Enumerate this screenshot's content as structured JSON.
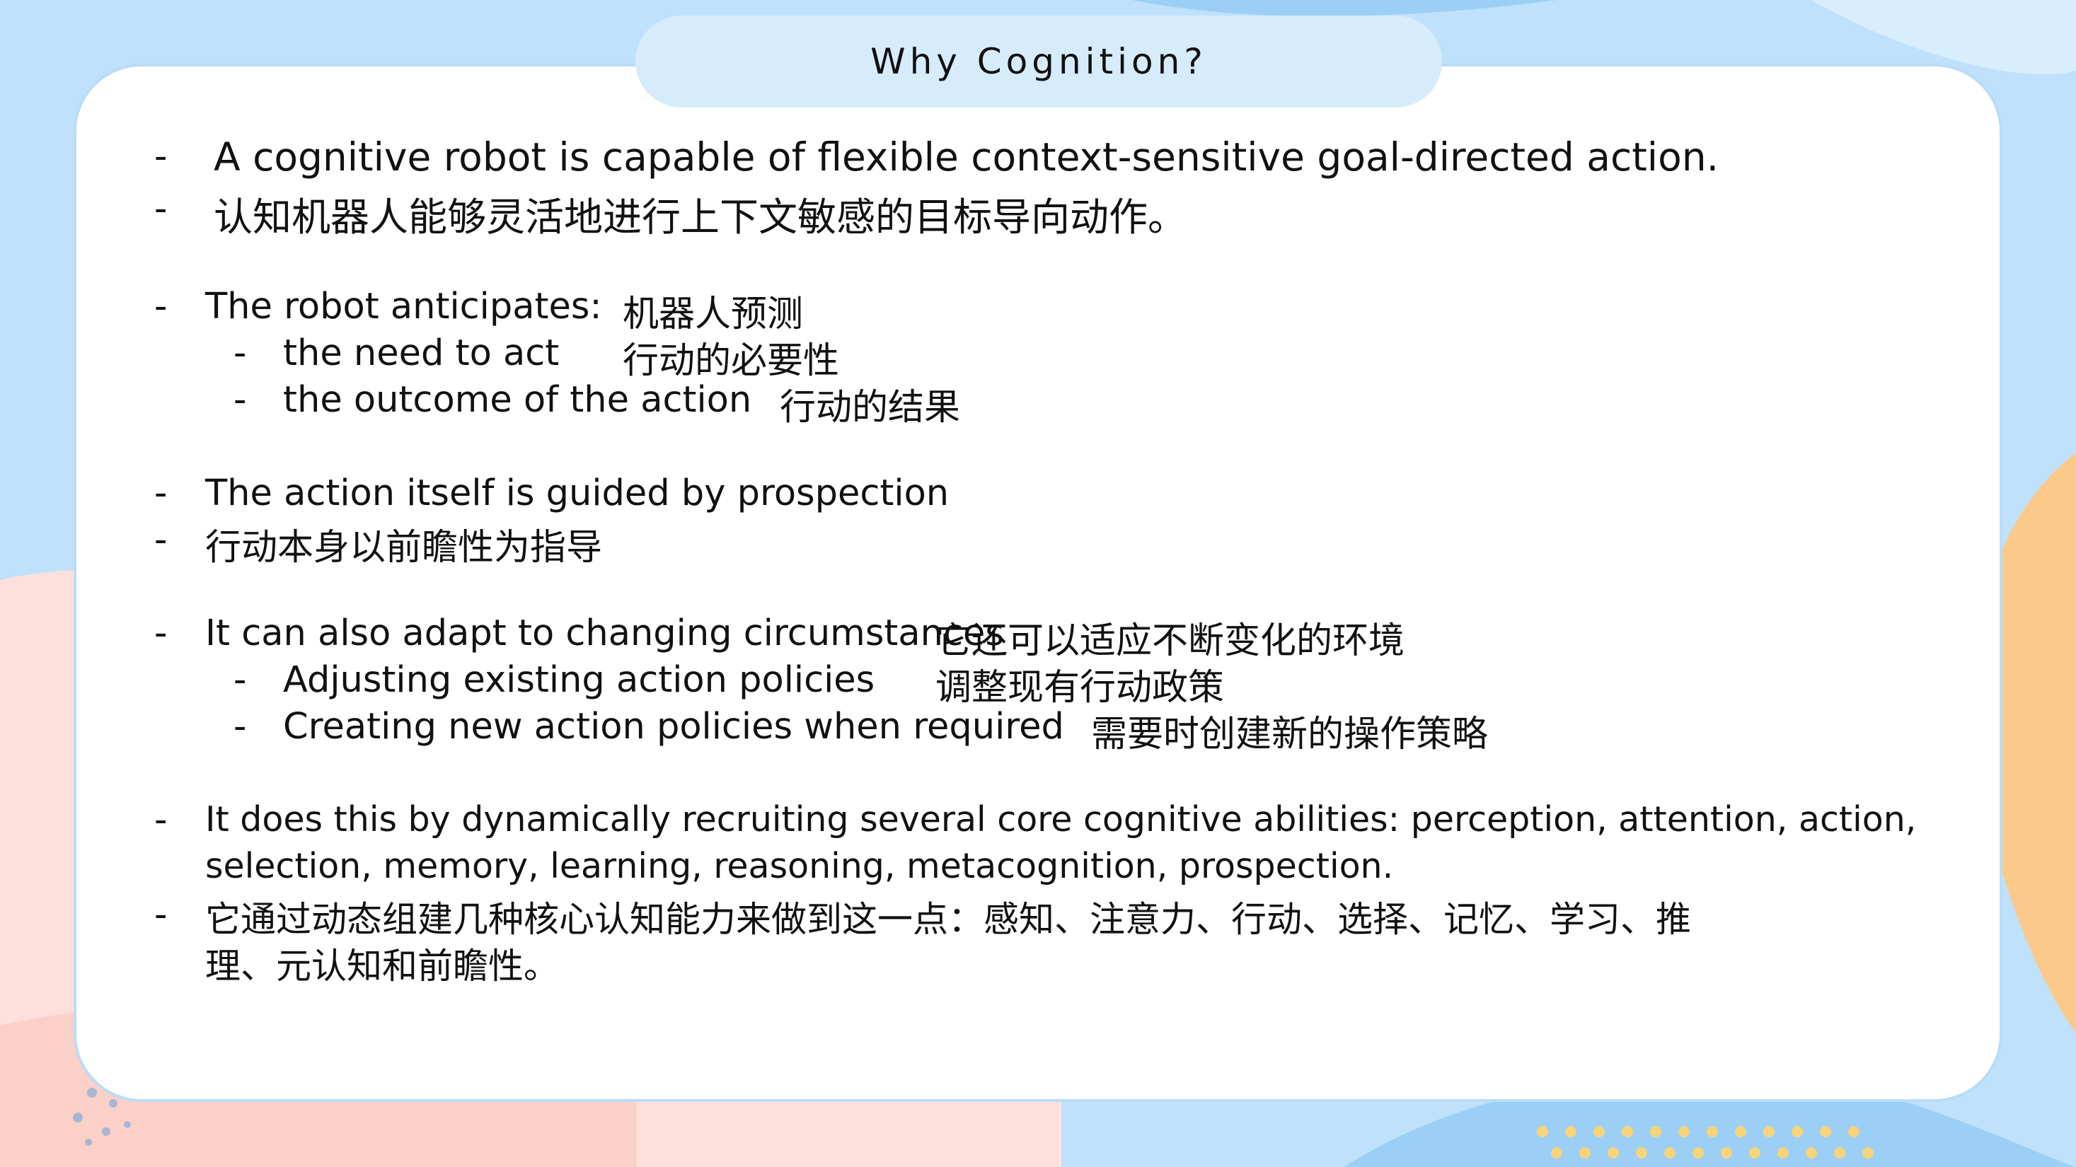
{
  "slide": {
    "title": "Why Cognition?",
    "bullets": {
      "b1_en": "A cognitive robot is capable of flexible context-sensitive goal-directed action.",
      "b1_zh": "认知机器人能够灵活地进行上下文敏感的目标导向动作。",
      "b2_en": "The robot anticipates:",
      "b2_zh": "机器人预测",
      "b2_sub1_en": "the need to act",
      "b2_sub1_zh": "行动的必要性",
      "b2_sub2_en": "the outcome of the action",
      "b2_sub2_zh": "行动的结果",
      "b3_en": "The action itself is guided by prospection",
      "b3_zh": "行动本身以前瞻性为指导",
      "b4_en": "It can also adapt to changing circumstances",
      "b4_zh": "它还可以适应不断变化的环境",
      "b4_sub1_en": "Adjusting existing action policies",
      "b4_sub1_zh": "调整现有行动政策",
      "b4_sub2_en": "Creating new action policies when required",
      "b4_sub2_zh": "需要时创建新的操作策略",
      "b5_en_line1": "It does this by dynamically recruiting several core cognitive abilities: perception, attention, action,",
      "b5_en_line2": "selection, memory, learning, reasoning, metacognition, prospection.",
      "b5_zh_line1": "它通过动态组建几种核心认知能力来做到这一点：感知、注意力、行动、选择、记忆、学习、推",
      "b5_zh_line2": "理、元认知和前瞻性。"
    },
    "dash": "-"
  },
  "colors": {
    "background_blue": "#bfe1fb",
    "accent_orange": "#fbc98a",
    "accent_pink": "#fde0dc",
    "dot_yellow": "#f7d47a",
    "card": "#ffffff",
    "title_pill": "#d6ecfb"
  }
}
